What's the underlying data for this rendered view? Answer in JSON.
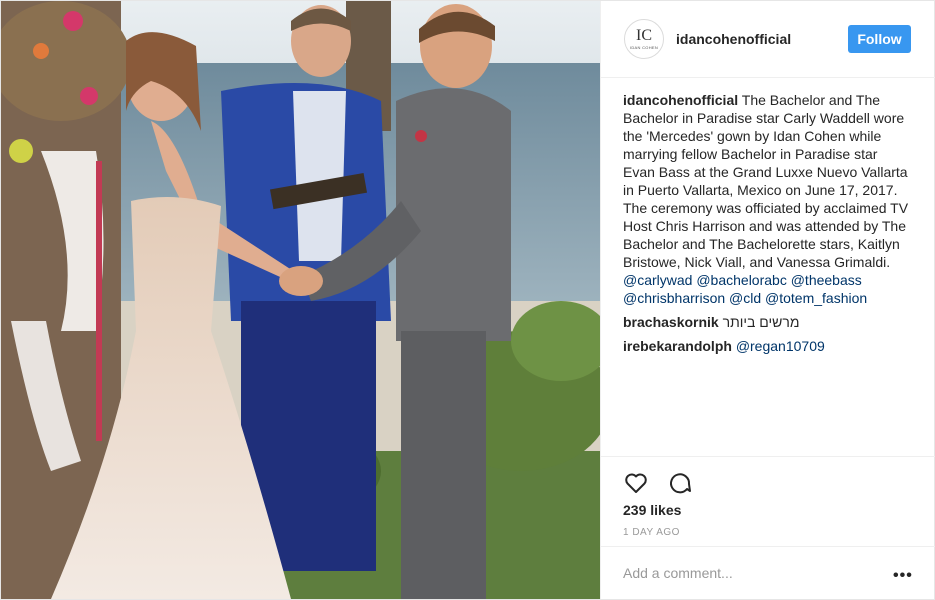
{
  "header": {
    "username": "idancohenofficial",
    "avatar_monogram": "IC",
    "avatar_brand": "IDAN COHEN",
    "follow_label": "Follow"
  },
  "comments": [
    {
      "user": "idancohenofficial",
      "text": "The Bachelor and The Bachelor in Paradise star Carly Waddell wore the 'Mercedes' gown by Idan Cohen while marrying fellow Bachelor in Paradise star Evan Bass at the Grand Luxxe Nuevo Vallarta in Puerto Vallarta, Mexico on June 17, 2017. The ceremony was officiated by acclaimed TV Host Chris Harrison and was attended by The Bachelor and The Bachelorette stars, Kaitlyn Bristowe, Nick Viall, and Vanessa Grimaldi.",
      "tags": "@carlywad @bachelorabc @theebass @chrisbharrison @cld @totem_fashion"
    },
    {
      "user": "brachaskornik",
      "text": "מרשים ביותר",
      "tags": ""
    },
    {
      "user": "irebekarandolph",
      "text": "",
      "tags": "@regan10709"
    }
  ],
  "actions": {
    "like_icon": "heart-outline-icon",
    "comment_icon": "speech-bubble-icon",
    "likes": "239 likes",
    "time": "1 DAY AGO"
  },
  "add_comment": {
    "placeholder": "Add a comment...",
    "more_label": "•••"
  },
  "colors": {
    "follow_bg": "#3897f0",
    "link": "#003569",
    "muted": "#999999",
    "border": "#efefef"
  }
}
